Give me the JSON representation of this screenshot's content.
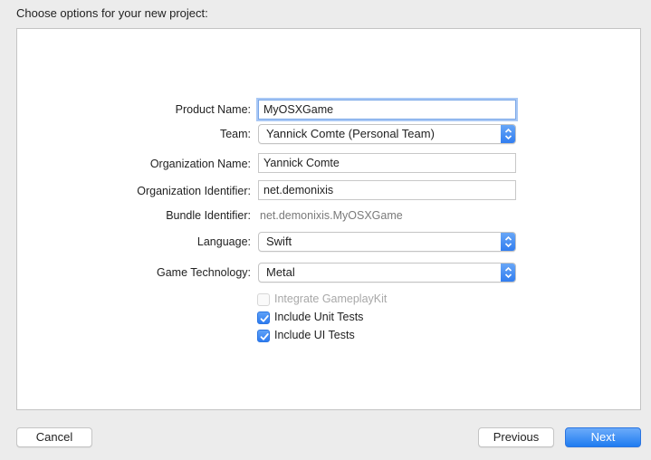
{
  "dialog": {
    "title": "Choose options for your new project:"
  },
  "form": {
    "product_name": {
      "label": "Product Name:",
      "value": "MyOSXGame"
    },
    "team": {
      "label": "Team:",
      "value": "Yannick Comte (Personal Team)"
    },
    "organization_name": {
      "label": "Organization Name:",
      "value": "Yannick Comte"
    },
    "organization_identifier": {
      "label": "Organization Identifier:",
      "value": "net.demonixis"
    },
    "bundle_identifier": {
      "label": "Bundle Identifier:",
      "value": "net.demonixis.MyOSXGame"
    },
    "language": {
      "label": "Language:",
      "value": "Swift"
    },
    "game_technology": {
      "label": "Game Technology:",
      "value": "Metal"
    },
    "options": [
      {
        "label": "Integrate GameplayKit",
        "checked": false,
        "enabled": false
      },
      {
        "label": "Include Unit Tests",
        "checked": true,
        "enabled": true
      },
      {
        "label": "Include UI Tests",
        "checked": true,
        "enabled": true
      }
    ]
  },
  "buttons": {
    "cancel": "Cancel",
    "previous": "Previous",
    "next": "Next"
  },
  "colors": {
    "accent": "#2f7cf0",
    "focus_ring": "#a9c8f5",
    "window_bg": "#ececec"
  },
  "icons": {
    "popup_stepper": "chevron-updown-icon",
    "checkbox_check": "checkmark-icon"
  }
}
